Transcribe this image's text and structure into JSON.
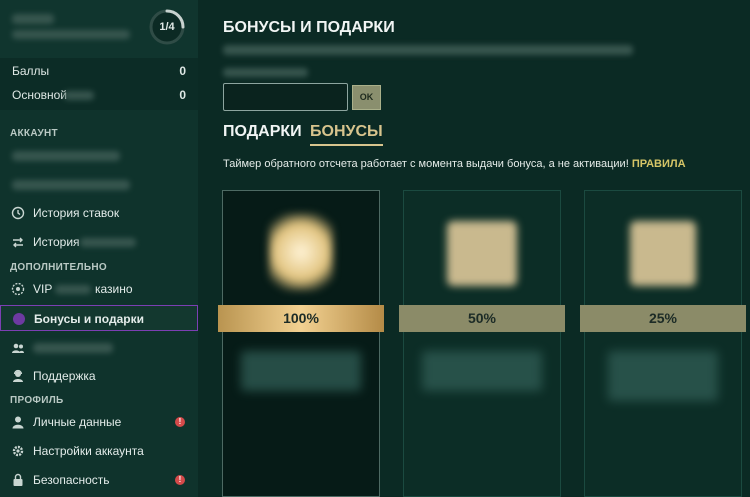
{
  "user": {
    "progress": {
      "label": "1/4",
      "value": 0.25
    }
  },
  "stats": [
    {
      "label": "Баллы",
      "value": "0"
    },
    {
      "label": "Основной",
      "value": "0"
    }
  ],
  "sections": {
    "account": "АККАУНТ",
    "extra": "ДОПОЛНИТЕЛЬНО",
    "profile": "ПРОФИЛЬ"
  },
  "nav": {
    "history_bets": {
      "label": "История ставок",
      "icon": "clock-icon"
    },
    "history_other": {
      "label": "История",
      "icon": "swap-arrows-icon"
    },
    "vip": {
      "label_prefix": "VIP",
      "label_suffix": "казино",
      "icon": "vip-badge-icon"
    },
    "bonuses": {
      "label": "Бонусы и подарки",
      "icon": "gift-icon"
    },
    "support": {
      "label": "Поддержка",
      "icon": "support-agent-icon"
    },
    "personal": {
      "label": "Личные данные",
      "icon": "user-icon",
      "alert": "!"
    },
    "settings": {
      "label": "Настройки аккаунта",
      "icon": "gear-icon"
    },
    "security": {
      "label": "Безопасность",
      "icon": "lock-icon",
      "alert": "!"
    }
  },
  "main": {
    "title": "БОНУСЫ И ПОДАРКИ",
    "ok_label": "OK",
    "tabs": {
      "gifts": "ПОДАРКИ",
      "bonuses": "БОНУСЫ"
    },
    "notice": "Таймер обратного отсчета работает с момента выдачи бонуса, а не активации!",
    "rules_link": "ПРАВИЛА",
    "cards": [
      {
        "percent": "100%"
      },
      {
        "percent": "50%"
      },
      {
        "percent": "25%"
      }
    ]
  },
  "colors": {
    "accent_gold": "#d8c48d",
    "active_border": "#7b3fb3",
    "alert_red": "#d44a4a",
    "rules_link": "#d6c567"
  }
}
